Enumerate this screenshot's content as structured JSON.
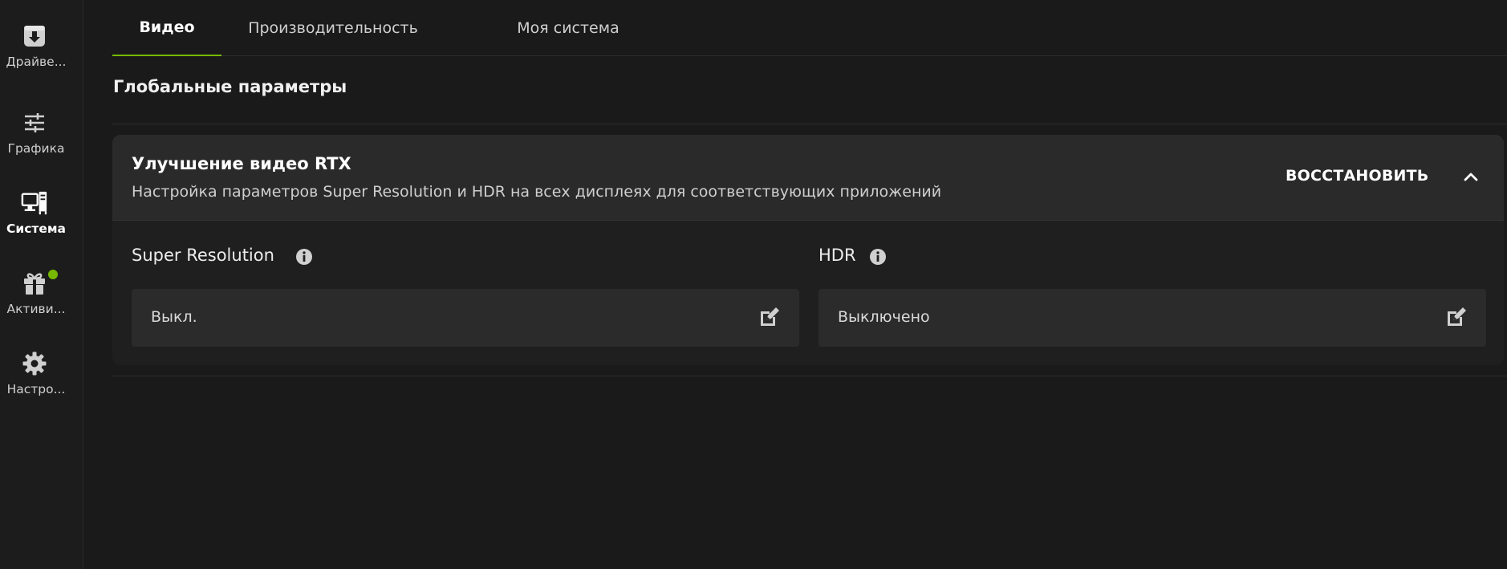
{
  "sidebar": {
    "items": [
      {
        "label": "Драйве...",
        "icon": "download-box-icon",
        "active": false
      },
      {
        "label": "Графика",
        "icon": "sliders-icon",
        "active": false
      },
      {
        "label": "Система",
        "icon": "monitor-tower-icon",
        "active": true
      },
      {
        "label": "Активи...",
        "icon": "gift-icon",
        "active": false,
        "badge": true
      },
      {
        "label": "Настро...",
        "icon": "gear-icon",
        "active": false
      }
    ]
  },
  "tabs": [
    {
      "label": "Видео",
      "active": true
    },
    {
      "label": "Производительность",
      "active": false
    },
    {
      "label": "Моя система",
      "active": false
    }
  ],
  "section": {
    "title": "Глобальные параметры"
  },
  "card": {
    "title": "Улучшение видео RTX",
    "subtitle": "Настройка параметров Super Resolution и HDR на всех дисплеях для соответствующих приложений",
    "restore_label": "ВОССТАНОВИТЬ",
    "settings": [
      {
        "label": "Super Resolution",
        "value": "Выкл."
      },
      {
        "label": "HDR",
        "value": "Выключено"
      }
    ]
  },
  "colors": {
    "accent": "#76b900",
    "background": "#1a1a1a",
    "card_header": "#2a2a2a",
    "field": "#2b2b2b"
  }
}
